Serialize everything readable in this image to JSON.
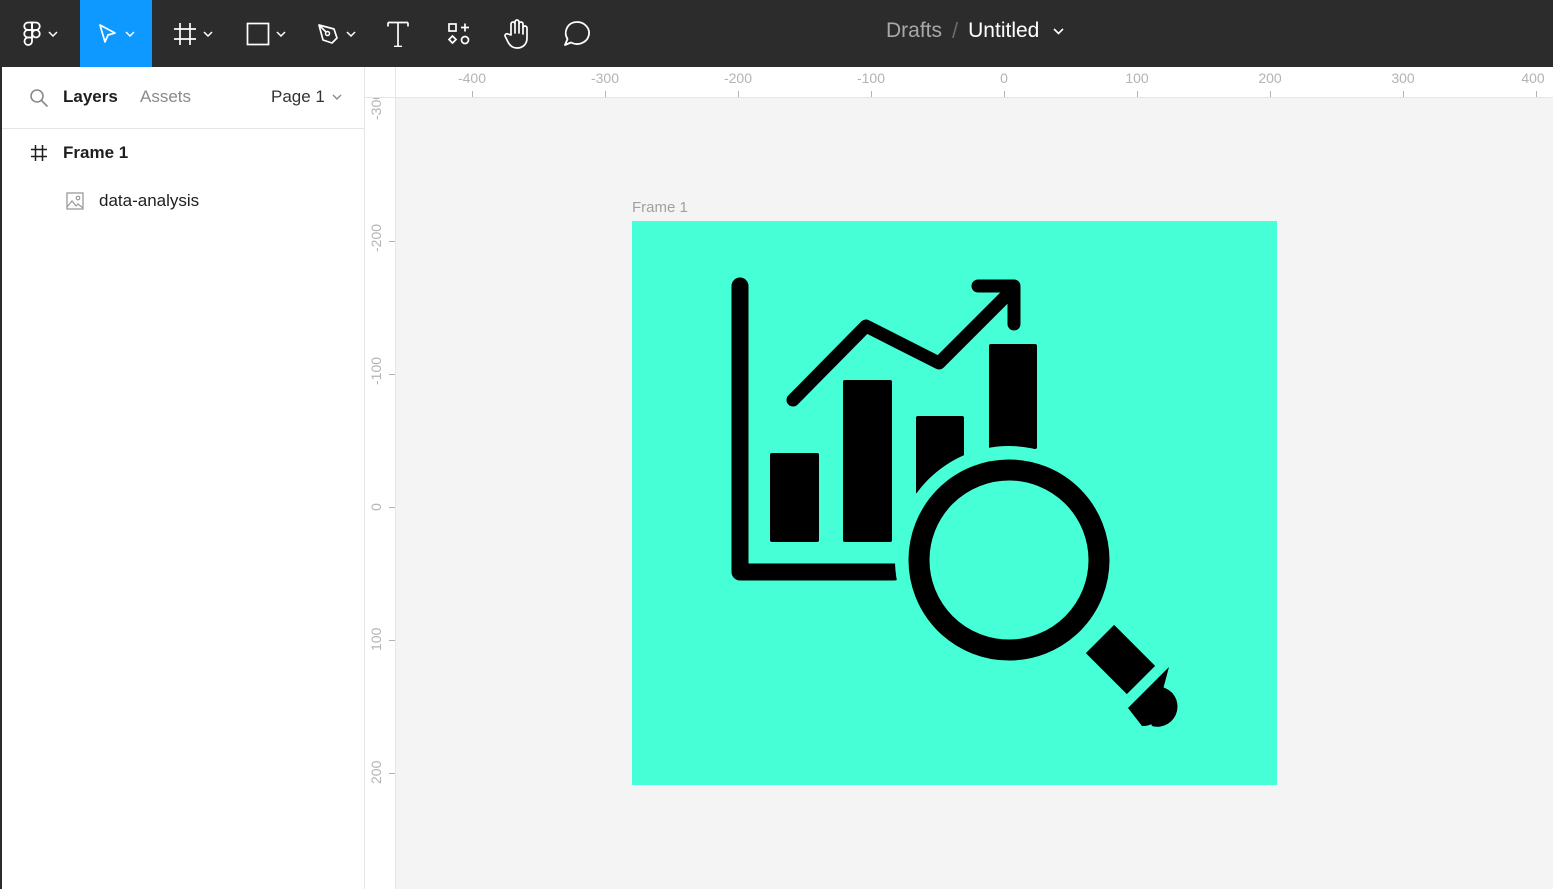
{
  "toolbar": {
    "tools": [
      "main-menu",
      "move",
      "frame",
      "shape",
      "pen",
      "text",
      "resources",
      "hand",
      "comment"
    ],
    "active_tool": "move",
    "breadcrumb": {
      "location": "Drafts",
      "separator": "/",
      "file_name": "Untitled"
    }
  },
  "left_panel": {
    "tabs": {
      "layers": "Layers",
      "assets": "Assets"
    },
    "page_selector": "Page 1",
    "layers": [
      {
        "name": "Frame 1",
        "type": "frame",
        "icon": "frame-icon"
      },
      {
        "name": "data-analysis",
        "type": "image",
        "icon": "image-icon"
      }
    ]
  },
  "rulers": {
    "top": [
      "-400",
      "-300",
      "-200",
      "-100",
      "0",
      "100",
      "200",
      "300",
      "400"
    ],
    "left": [
      "-300",
      "-200",
      "-100",
      "0",
      "100",
      "200"
    ]
  },
  "canvas": {
    "frame_label": "Frame 1",
    "frame_fill": "#47ffd6",
    "image_content": "data-analysis"
  },
  "colors": {
    "toolbar_bg": "#2c2c2c",
    "accent": "#0d99ff",
    "canvas_bg": "#f4f4f4",
    "frame_fill": "#47ffd6"
  }
}
